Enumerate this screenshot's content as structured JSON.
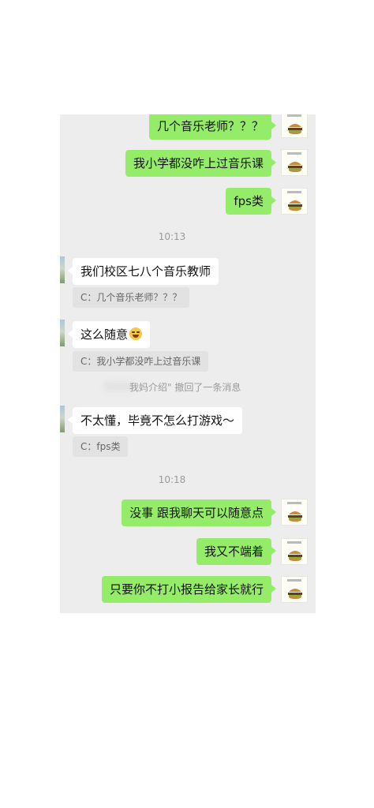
{
  "chat": {
    "top_messages": [
      {
        "text": "几个音乐老师？？？"
      },
      {
        "text": "我小学都没咋上过音乐课"
      },
      {
        "text": "fps类"
      }
    ],
    "time_1": "10:13",
    "reply_1": {
      "text": "我们校区七八个音乐教师",
      "quote": "C：几个音乐老师？？？"
    },
    "reply_2": {
      "text": "这么随意",
      "quote": "C：我小学都没咋上过音乐课"
    },
    "recall_notice": "我妈介绍\" 撤回了一条消息",
    "reply_3": {
      "text": "不太懂，毕竟不怎么打游戏～",
      "quote": "C：fps类"
    },
    "time_2": "10:18",
    "bottom_messages": [
      {
        "text": "没事 跟我聊天可以随意点"
      },
      {
        "text": "我又不端着"
      },
      {
        "text": "只要你不打小报告给家长就行"
      }
    ]
  },
  "colors": {
    "outgoing_bubble": "#95ec69",
    "incoming_bubble": "#ffffff",
    "chat_background": "#ededed"
  },
  "icons": {
    "self_avatar": "burger-icon",
    "emoji": "laughing-tears-emoji"
  }
}
